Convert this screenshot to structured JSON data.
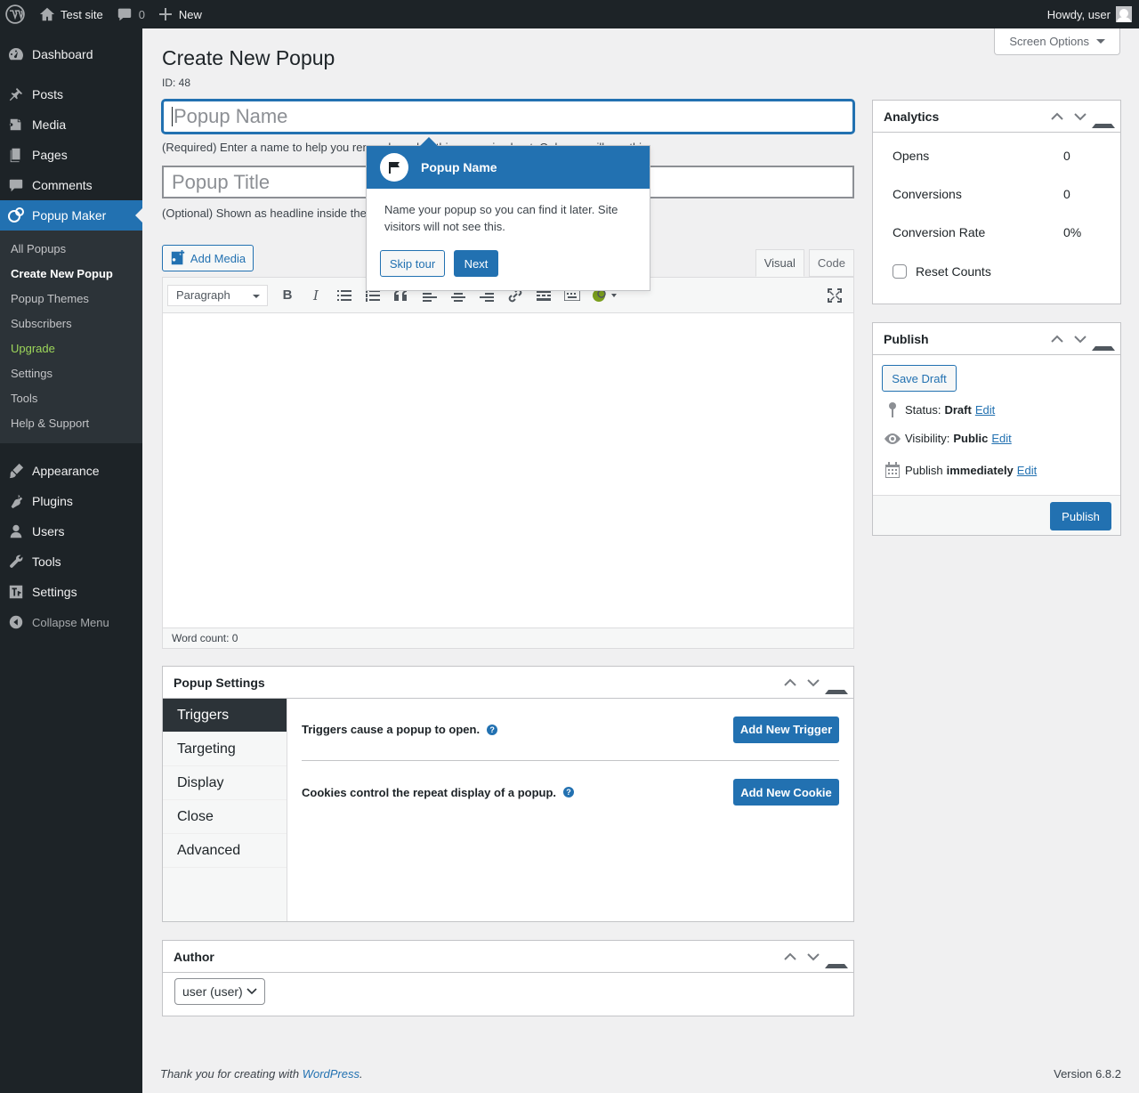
{
  "adminbar": {
    "site_name": "Test site",
    "comments_count": "0",
    "new_label": "New",
    "howdy": "Howdy, user"
  },
  "sidebar": {
    "items_top": [
      {
        "label": "Dashboard",
        "icon": "dashboard-icon"
      }
    ],
    "items_mid": [
      {
        "label": "Posts",
        "icon": "pin-icon"
      },
      {
        "label": "Media",
        "icon": "media-icon"
      },
      {
        "label": "Pages",
        "icon": "pages-icon"
      },
      {
        "label": "Comments",
        "icon": "comments-icon"
      }
    ],
    "current": {
      "label": "Popup Maker",
      "icon": "popup-maker-icon"
    },
    "submenu": [
      "All Popups",
      "Create New Popup",
      "Popup Themes",
      "Subscribers",
      "Upgrade",
      "Settings",
      "Tools",
      "Help & Support"
    ],
    "items_bottom": [
      {
        "label": "Appearance",
        "icon": "brush-icon"
      },
      {
        "label": "Plugins",
        "icon": "plugin-icon"
      },
      {
        "label": "Users",
        "icon": "users-icon"
      },
      {
        "label": "Tools",
        "icon": "wrench-icon"
      },
      {
        "label": "Settings",
        "icon": "settings-icon"
      }
    ],
    "collapse": "Collapse Menu"
  },
  "header": {
    "screen_options": "Screen Options",
    "title": "Create New Popup",
    "post_id": "ID: 48"
  },
  "form": {
    "name_placeholder": "Popup Name",
    "name_help": "(Required) Enter a name to help you remember what this popup is about. Only you will see this.",
    "title_placeholder": "Popup Title",
    "title_help": "(Optional) Shown as headline inside the popup. Can be left blank."
  },
  "editor": {
    "add_media": "Add Media",
    "tab_visual": "Visual",
    "tab_code": "Code",
    "format": "Paragraph",
    "word_count": "Word count: 0"
  },
  "tour": {
    "title": "Popup Name",
    "body": "Name your popup so you can find it later. Site visitors will not see this.",
    "skip": "Skip tour",
    "next": "Next"
  },
  "popup_settings": {
    "title": "Popup Settings",
    "tabs": [
      "Triggers",
      "Targeting",
      "Display",
      "Close",
      "Advanced"
    ],
    "triggers_text": "Triggers cause a popup to open.",
    "add_trigger": "Add New Trigger",
    "cookies_text": "Cookies control the repeat display of a popup.",
    "add_cookie": "Add New Cookie"
  },
  "author": {
    "title": "Author",
    "selected": "user (user)"
  },
  "analytics": {
    "title": "Analytics",
    "rows": [
      {
        "label": "Opens",
        "value": "0"
      },
      {
        "label": "Conversions",
        "value": "0"
      },
      {
        "label": "Conversion Rate",
        "value": "0%"
      }
    ],
    "reset": "Reset Counts"
  },
  "publish": {
    "title": "Publish",
    "save_draft": "Save Draft",
    "status_label": "Status:",
    "status_value": "Draft",
    "visibility_label": "Visibility:",
    "visibility_value": "Public",
    "publish_label": "Publish",
    "publish_value": "immediately",
    "edit": "Edit",
    "publish_button": "Publish"
  },
  "footer": {
    "thanks_prefix": "Thank you for creating with ",
    "wp_link": "WordPress",
    "thanks_suffix": ".",
    "version": "Version 6.8.2"
  },
  "colors": {
    "accent": "#2271b1",
    "admin_dark": "#1d2327",
    "upgrade": "#9dd65a"
  }
}
